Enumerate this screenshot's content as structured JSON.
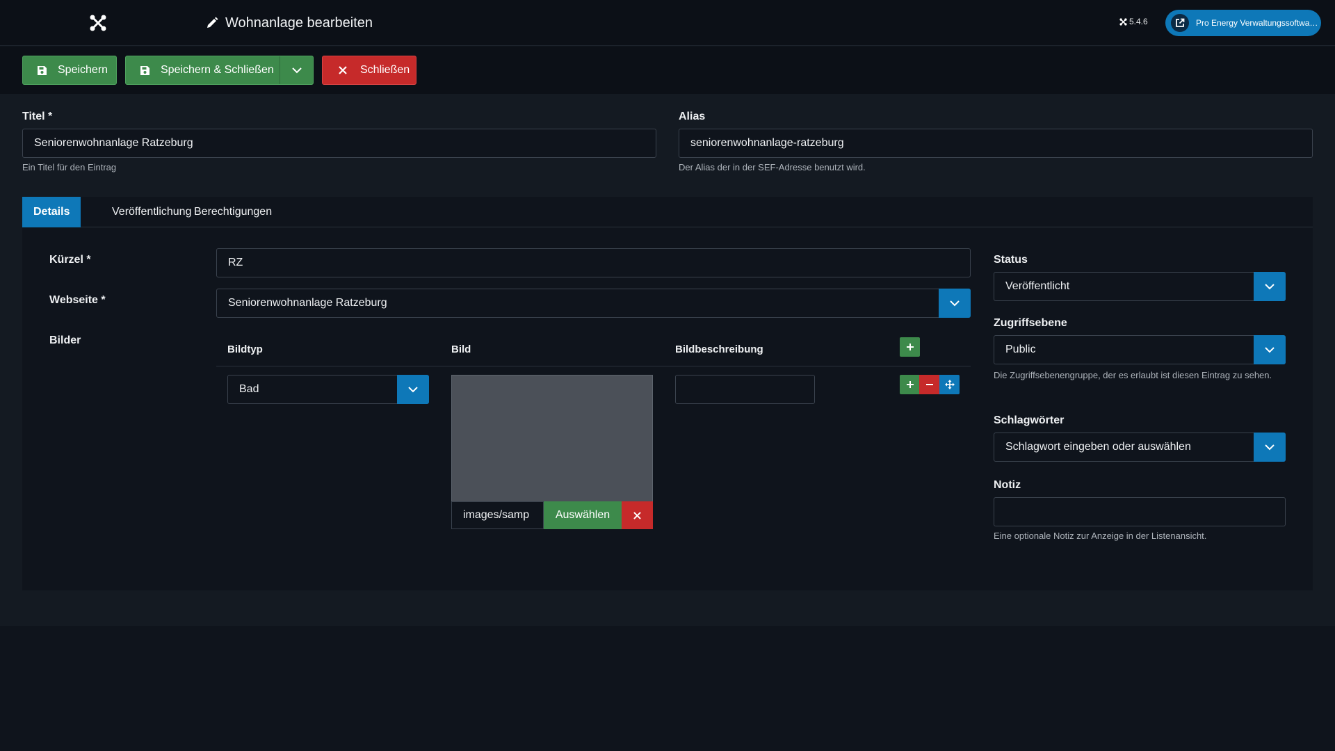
{
  "header": {
    "logo_icon": "joomla-logo-icon",
    "title_icon": "pencil-icon",
    "title": "Wohnanlage bearbeiten",
    "version": "5.4.6",
    "site_button": "Pro Energy Verwaltungssoftwa…",
    "site_button_icon": "external-link-icon"
  },
  "toolbar": {
    "save": "Speichern",
    "save_close": "Speichern & Schließen",
    "close": "Schließen"
  },
  "form": {
    "title_label": "Titel *",
    "title_value": "Seniorenwohnanlage Ratzeburg",
    "title_hint": "Ein Titel für den Eintrag",
    "alias_label": "Alias",
    "alias_value": "seniorenwohnanlage-ratzeburg",
    "alias_hint": "Der Alias der in der SEF-Adresse benutzt wird."
  },
  "tabs": [
    {
      "label": "Details",
      "active": true
    },
    {
      "label": "Veröffentlichung",
      "active": false
    },
    {
      "label": "Berechtigungen",
      "active": false
    }
  ],
  "details": {
    "kuerzel_label": "Kürzel *",
    "kuerzel_value": "RZ",
    "webseite_label": "Webseite *",
    "webseite_value": "Seniorenwohnanlage Ratzeburg",
    "bilder_label": "Bilder",
    "table_headers": [
      "Bildtyp",
      "Bild",
      "Bildbeschreibung"
    ],
    "row": {
      "bildtyp": "Bad",
      "bild_path": "images/samp",
      "bild_pick": "Auswählen",
      "bildbeschreibung": ""
    }
  },
  "sidebar": {
    "status_label": "Status",
    "status_value": "Veröffentlicht",
    "access_label": "Zugriffsebene",
    "access_value": "Public",
    "access_hint": "Die Zugriffsebenengruppe, der es erlaubt ist diesen Eintrag zu sehen.",
    "tags_label": "Schlagwörter",
    "tags_value": "Schlagwort eingeben oder auswählen",
    "note_label": "Notiz",
    "note_value": "",
    "note_hint": "Eine optionale Notiz zur Anzeige in der Listenansicht."
  },
  "colors": {
    "primary": "#0e78b8",
    "success": "#3d8a4b",
    "danger": "#c62a2a",
    "background": "#0f141c"
  }
}
